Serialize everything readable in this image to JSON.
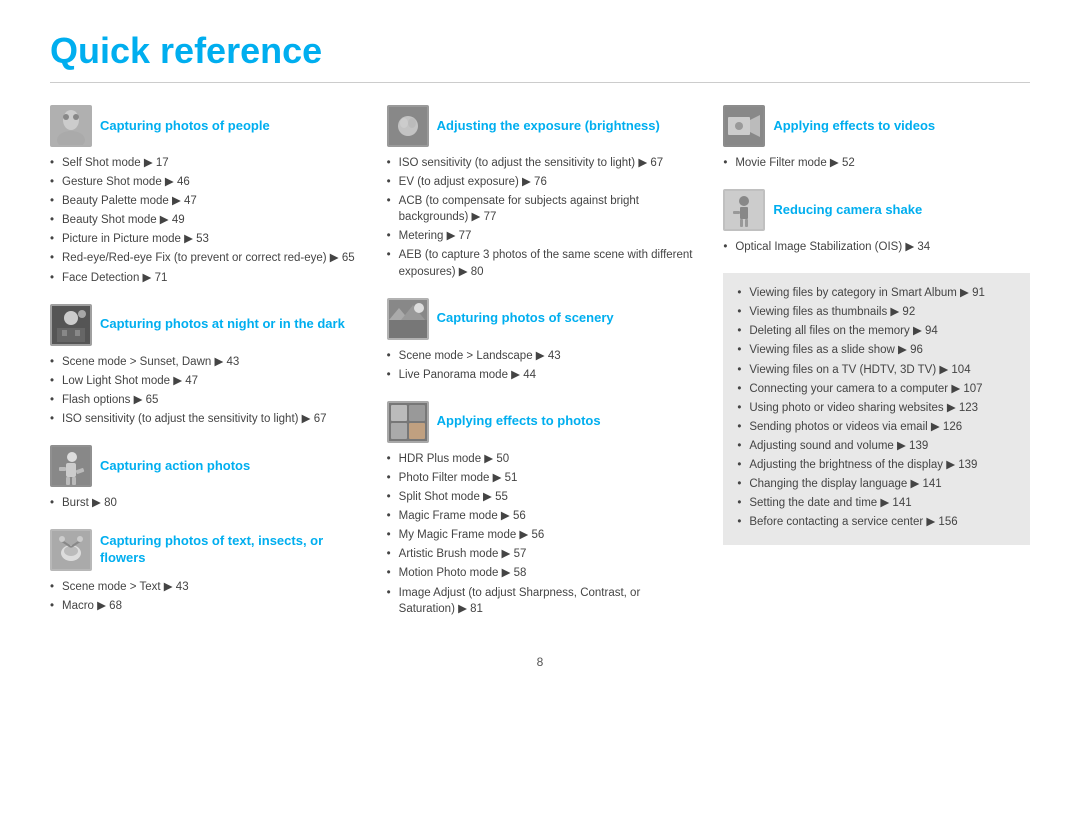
{
  "page": {
    "title": "Quick reference",
    "page_number": "8"
  },
  "columns": [
    {
      "id": "col1",
      "sections": [
        {
          "id": "people",
          "title": "Capturing photos of people",
          "thumb_label": "people-thumb",
          "items": [
            "Self Shot mode ▶ 17",
            "Gesture Shot mode ▶ 46",
            "Beauty Palette mode ▶ 47",
            "Beauty Shot mode ▶ 49",
            "Picture in Picture mode ▶ 53",
            "Red-eye/Red-eye Fix (to prevent or correct red-eye) ▶ 65",
            "Face Detection ▶ 71"
          ]
        },
        {
          "id": "night",
          "title": "Capturing photos at night or in the dark",
          "thumb_label": "night-thumb",
          "items": [
            "Scene mode > Sunset, Dawn ▶ 43",
            "Low Light Shot mode ▶ 47",
            "Flash options ▶ 65",
            "ISO sensitivity (to adjust the sensitivity to light) ▶ 67"
          ]
        },
        {
          "id": "action",
          "title": "Capturing action photos",
          "thumb_label": "action-thumb",
          "items": [
            "Burst ▶ 80"
          ]
        },
        {
          "id": "text",
          "title": "Capturing photos of text, insects, or flowers",
          "thumb_label": "text-thumb",
          "items": [
            "Scene mode > Text ▶ 43",
            "Macro ▶ 68"
          ]
        }
      ]
    },
    {
      "id": "col2",
      "sections": [
        {
          "id": "exposure",
          "title": "Adjusting the exposure (brightness)",
          "thumb_label": "exposure-thumb",
          "items": [
            "ISO sensitivity (to adjust the sensitivity to light) ▶ 67",
            "EV (to adjust exposure) ▶ 76",
            "ACB (to compensate for subjects against bright backgrounds) ▶ 77",
            "Metering ▶ 77",
            "AEB (to capture 3 photos of the same scene with different exposures) ▶ 80"
          ]
        },
        {
          "id": "scenery",
          "title": "Capturing photos of scenery",
          "thumb_label": "scenery-thumb",
          "items": [
            "Scene mode > Landscape ▶ 43",
            "Live Panorama mode ▶ 44"
          ]
        },
        {
          "id": "effects-photos",
          "title": "Applying effects to photos",
          "thumb_label": "effects-photos-thumb",
          "items": [
            "HDR Plus mode ▶ 50",
            "Photo Filter mode ▶ 51",
            "Split Shot mode ▶ 55",
            "Magic Frame mode ▶ 56",
            "My Magic Frame mode ▶ 56",
            "Artistic Brush mode ▶ 57",
            "Motion Photo mode ▶ 58",
            "Image Adjust (to adjust Sharpness, Contrast, or Saturation) ▶ 81"
          ]
        }
      ]
    },
    {
      "id": "col3",
      "sections": [
        {
          "id": "effects-videos",
          "title": "Applying effects to videos",
          "thumb_label": "effects-videos-thumb",
          "items": [
            "Movie Filter mode ▶ 52"
          ]
        },
        {
          "id": "shake",
          "title": "Reducing camera shake",
          "thumb_label": "shake-thumb",
          "items": [
            "Optical Image Stabilization (OIS) ▶ 34"
          ]
        }
      ],
      "box_items": [
        "Viewing files by category in Smart Album ▶ 91",
        "Viewing files as thumbnails ▶ 92",
        "Deleting all files on the memory ▶ 94",
        "Viewing files as a slide show ▶ 96",
        "Viewing files on a TV (HDTV, 3D TV) ▶ 104",
        "Connecting your camera to a computer ▶ 107",
        "Using photo or video sharing websites ▶ 123",
        "Sending photos or videos via email ▶ 126",
        "Adjusting sound and volume ▶ 139",
        "Adjusting the brightness of the display ▶ 139",
        "Changing the display language ▶ 141",
        "Setting the date and time ▶ 141",
        "Before contacting a service center ▶ 156"
      ]
    }
  ]
}
